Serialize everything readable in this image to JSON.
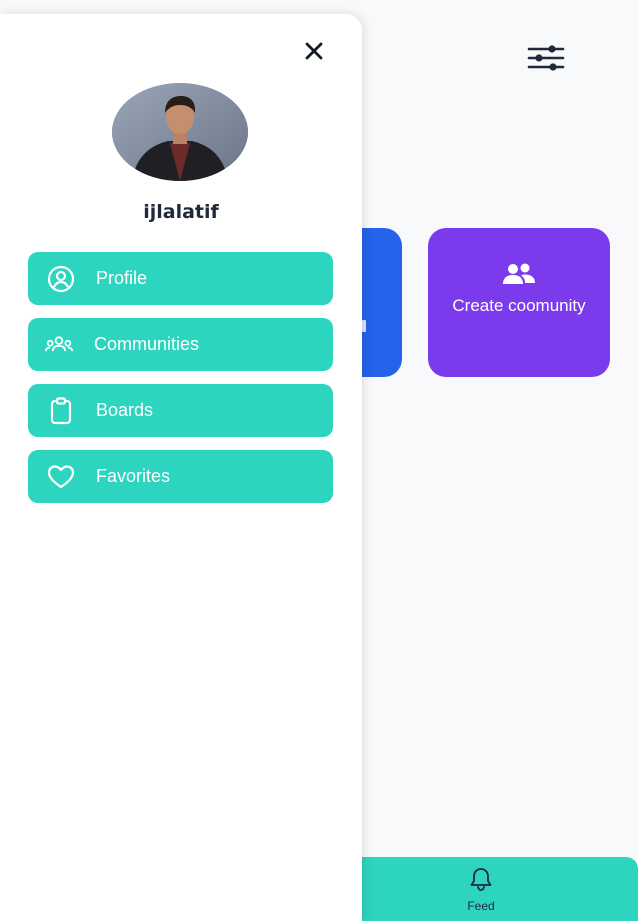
{
  "colors": {
    "teal": "#2dd4bf",
    "purple": "#7c3aed",
    "blue": "#2563eb",
    "text_dark": "#1f2937"
  },
  "drawer": {
    "username": "ijlalatif",
    "close_icon": "close-icon",
    "menu": [
      {
        "label": "Profile",
        "icon": "user-circle-icon"
      },
      {
        "label": "Communities",
        "icon": "users-group-icon"
      },
      {
        "label": "Boards",
        "icon": "clipboard-icon"
      },
      {
        "label": "Favorites",
        "icon": "heart-icon"
      }
    ]
  },
  "header": {
    "filter_icon": "sliders-icon"
  },
  "cards": {
    "create_community": {
      "title": "Create coomunity",
      "icon": "users-icon"
    }
  },
  "bottom_nav": {
    "feed_label": "Feed",
    "feed_icon": "bell-icon"
  }
}
